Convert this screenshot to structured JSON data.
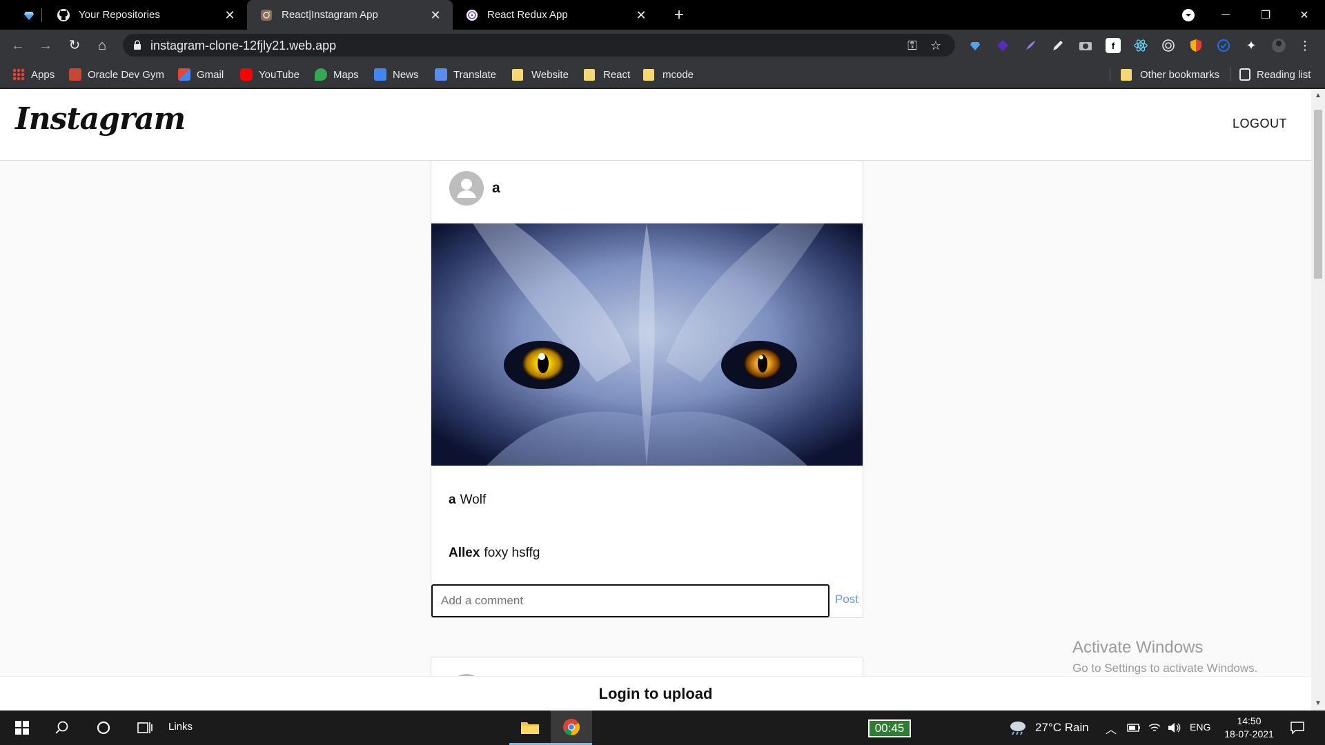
{
  "tabs": [
    {
      "title": "Your Repositories"
    },
    {
      "title": "React|Instagram App"
    },
    {
      "title": "React Redux App"
    }
  ],
  "address_bar": {
    "url": "instagram-clone-12fjly21.web.app"
  },
  "bookmarks": {
    "items": [
      "Apps",
      "Oracle Dev Gym",
      "Gmail",
      "YouTube",
      "Maps",
      "News",
      "Translate",
      "Website",
      "React",
      "mcode"
    ],
    "other": "Other bookmarks",
    "reading_list": "Reading list"
  },
  "app": {
    "logo": "Instagram",
    "logout_label": "LOGOUT",
    "post": {
      "username": "a",
      "caption_user": "a",
      "caption_text": "Wolf",
      "comments": [
        {
          "user": "Allex",
          "text": "foxy hsffg"
        }
      ],
      "comment_placeholder": "Add a comment",
      "post_label": "Post"
    },
    "upload_message": "Login to upload"
  },
  "watermark": {
    "title": "Activate Windows",
    "subtitle": "Go to Settings to activate Windows."
  },
  "taskbar": {
    "links_label": "Links",
    "timer": "00:45",
    "weather": "27°C  Rain",
    "language": "ENG",
    "time": "14:50",
    "date": "18-07-2021"
  },
  "colors": {
    "accent_link": "#6a9bd8",
    "chrome_dark": "#35363a",
    "timer_bg": "#2e7d32"
  }
}
